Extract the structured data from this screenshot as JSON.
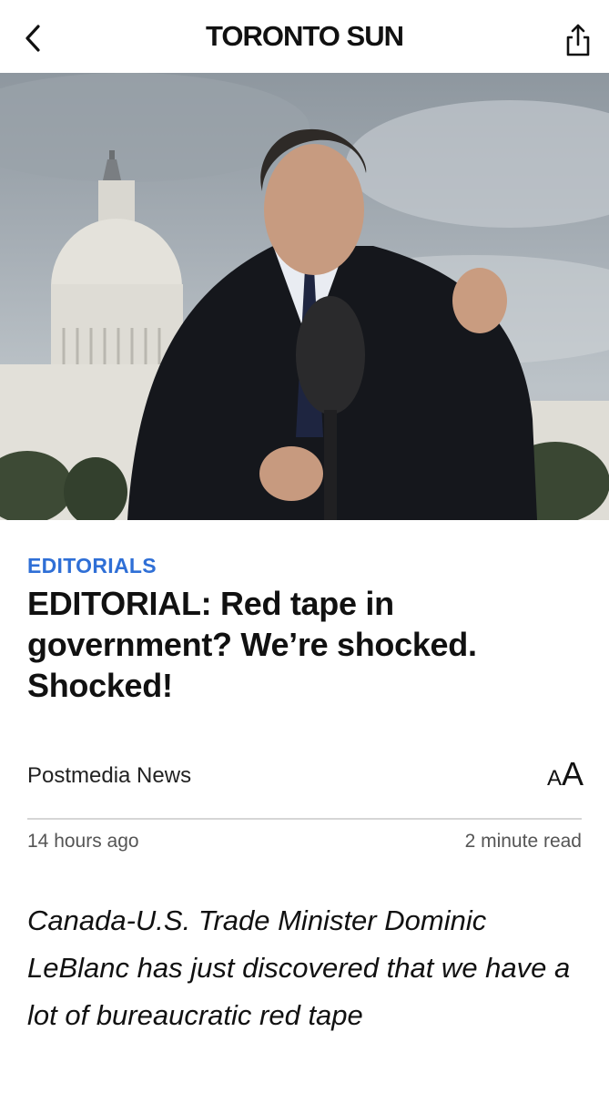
{
  "header": {
    "logo_primary": "TORONTO",
    "logo_secondary": "SUN",
    "back_icon": "chevron-left-icon",
    "share_icon": "share-icon"
  },
  "hero": {
    "image": "man-speaking-at-microphone-in-front-of-capitol-photo"
  },
  "article": {
    "section": "EDITORIALS",
    "headline": "EDITORIAL: Red tape in government? We’re shocked. Shocked!",
    "author": "Postmedia News",
    "text_size_small": "A",
    "text_size_large": "A",
    "published": "14 hours ago",
    "read_time": "2 minute read",
    "lede": "Canada-U.S. Trade Minister Dominic LeBlanc has just discovered that we have a lot of bureaucratic red tape"
  },
  "colors": {
    "section_accent": "#2f6fd6",
    "text": "#111111",
    "meta_text": "#555555",
    "divider": "#d6d6d6"
  }
}
